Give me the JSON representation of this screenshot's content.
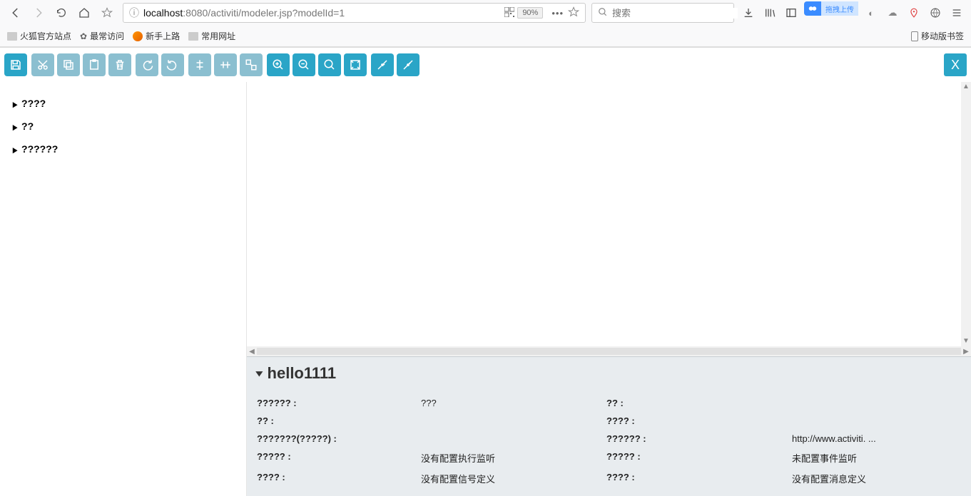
{
  "browser": {
    "url_host": "localhost",
    "url_port_path": ":8080/activiti/modeler.jsp?modelId=1",
    "zoom": "90%",
    "search_placeholder": "搜索"
  },
  "bookmarks": {
    "items": [
      {
        "label": "火狐官方站点"
      },
      {
        "label": "最常访问"
      },
      {
        "label": "新手上路"
      },
      {
        "label": "常用网址"
      }
    ],
    "mobile": "移动版书签"
  },
  "baidu_upload": "拖拽上传",
  "toolbar": {
    "close": "X"
  },
  "palette": {
    "items": [
      {
        "label": "????"
      },
      {
        "label": "??"
      },
      {
        "label": "??????"
      }
    ]
  },
  "properties": {
    "title": "hello1111",
    "rows": [
      {
        "l1": "?????? :",
        "v1": "???",
        "l2": "?? :",
        "v2": ""
      },
      {
        "l1": "?? :",
        "v1": "",
        "l2": "???? :",
        "v2": ""
      },
      {
        "l1": "???????(?????) :",
        "v1": "",
        "l2": "?????? :",
        "v2": "http://www.activiti. ..."
      },
      {
        "l1": "????? :",
        "v1": "没有配置执行监听",
        "l2": "????? :",
        "v2": "未配置事件监听"
      },
      {
        "l1": "???? :",
        "v1": "没有配置信号定义",
        "l2": "???? :",
        "v2": "没有配置消息定义"
      }
    ]
  }
}
